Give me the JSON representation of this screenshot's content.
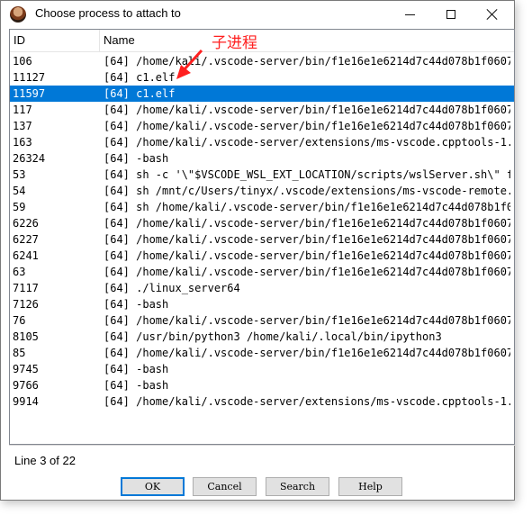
{
  "window": {
    "title": "Choose process to attach to"
  },
  "columns": {
    "id": "ID",
    "name": "Name"
  },
  "rows": [
    {
      "id": "106",
      "name": "[64] /home/kali/.vscode-server/bin/f1e16e1e6214d7c44d078b1f0607..."
    },
    {
      "id": "11127",
      "name": "[64] c1.elf"
    },
    {
      "id": "11597",
      "name": "[64] c1.elf"
    },
    {
      "id": "117",
      "name": "[64] /home/kali/.vscode-server/bin/f1e16e1e6214d7c44d078b1f0607..."
    },
    {
      "id": "137",
      "name": "[64] /home/kali/.vscode-server/bin/f1e16e1e6214d7c44d078b1f0607..."
    },
    {
      "id": "163",
      "name": "[64] /home/kali/.vscode-server/extensions/ms-vscode.cpptools-1..."
    },
    {
      "id": "26324",
      "name": "[64] -bash"
    },
    {
      "id": "53",
      "name": "[64] sh -c '\\\"$VSCODE_WSL_EXT_LOCATION/scripts/wslServer.sh\\\" f..."
    },
    {
      "id": "54",
      "name": "[64] sh /mnt/c/Users/tinyx/.vscode/extensions/ms-vscode-remote..."
    },
    {
      "id": "59",
      "name": "[64] sh /home/kali/.vscode-server/bin/f1e16e1e6214d7c44d078b1f0..."
    },
    {
      "id": "6226",
      "name": "[64] /home/kali/.vscode-server/bin/f1e16e1e6214d7c44d078b1f0607..."
    },
    {
      "id": "6227",
      "name": "[64] /home/kali/.vscode-server/bin/f1e16e1e6214d7c44d078b1f0607..."
    },
    {
      "id": "6241",
      "name": "[64] /home/kali/.vscode-server/bin/f1e16e1e6214d7c44d078b1f0607..."
    },
    {
      "id": "63",
      "name": "[64] /home/kali/.vscode-server/bin/f1e16e1e6214d7c44d078b1f0607..."
    },
    {
      "id": "7117",
      "name": "[64] ./linux_server64"
    },
    {
      "id": "7126",
      "name": "[64] -bash"
    },
    {
      "id": "76",
      "name": "[64] /home/kali/.vscode-server/bin/f1e16e1e6214d7c44d078b1f0607..."
    },
    {
      "id": "8105",
      "name": "[64] /usr/bin/python3 /home/kali/.local/bin/ipython3"
    },
    {
      "id": "85",
      "name": "[64] /home/kali/.vscode-server/bin/f1e16e1e6214d7c44d078b1f0607..."
    },
    {
      "id": "9745",
      "name": "[64] -bash"
    },
    {
      "id": "9766",
      "name": "[64] -bash"
    },
    {
      "id": "9914",
      "name": "[64] /home/kali/.vscode-server/extensions/ms-vscode.cpptools-1..."
    }
  ],
  "selected_row_number": 3,
  "status": {
    "text": "Line 3 of 22"
  },
  "buttons": {
    "ok": "OK",
    "cancel": "Cancel",
    "search": "Search",
    "help": "Help"
  },
  "annotation": {
    "label": "子进程",
    "color": "#ff2020"
  },
  "colors": {
    "selection": "#0078d7",
    "ok_border": "#0078d7"
  },
  "icons": {
    "app": "app-avatar-icon",
    "minimize": "minimize-icon",
    "maximize": "maximize-icon",
    "close": "close-icon",
    "arrow": "arrow-icon"
  }
}
